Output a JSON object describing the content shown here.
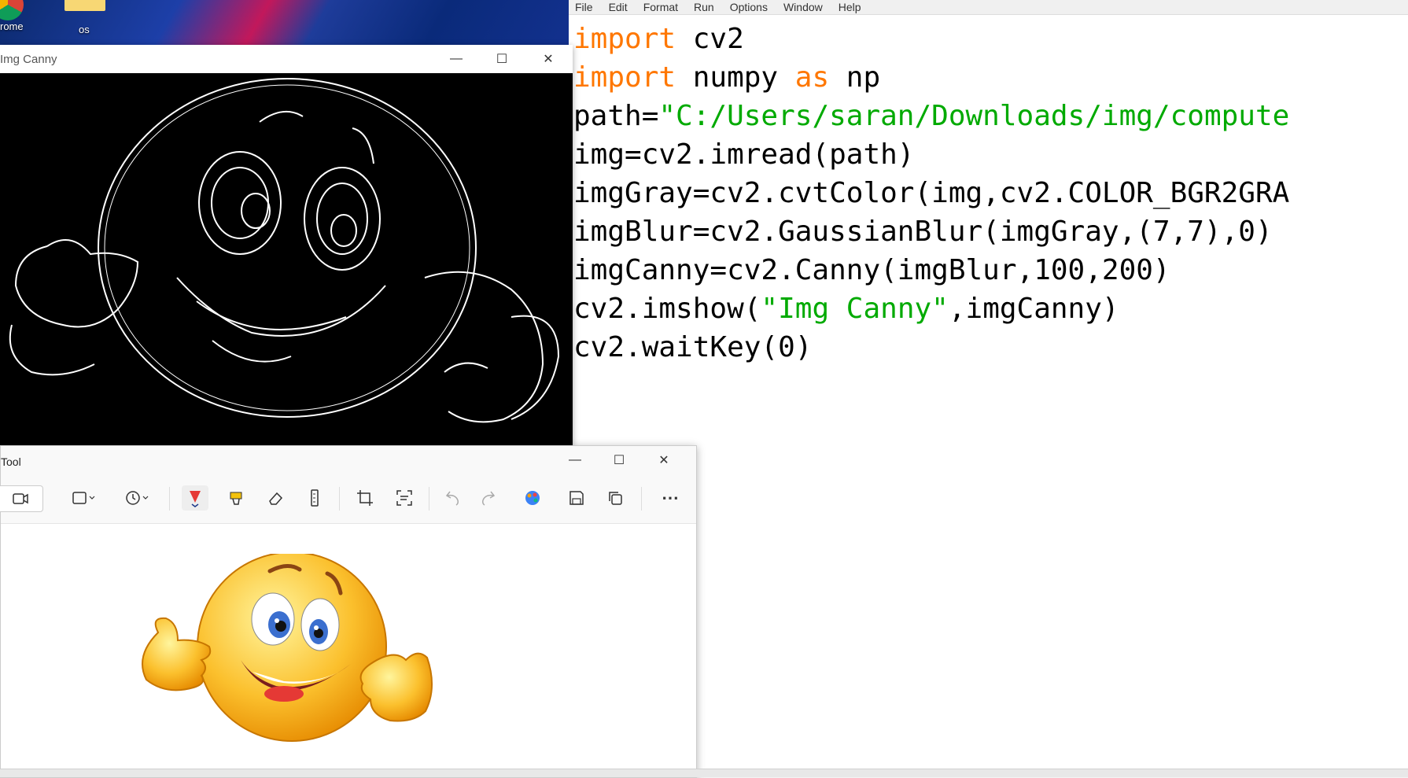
{
  "desktop": {
    "icons": [
      {
        "label": "rome",
        "icon": "chrome-icon"
      },
      {
        "label": "os",
        "icon": "folder-icon"
      }
    ]
  },
  "idle": {
    "menu": [
      "File",
      "Edit",
      "Format",
      "Run",
      "Options",
      "Window",
      "Help"
    ],
    "code": [
      "import cv2",
      "import numpy as np",
      "path=\"C:/Users/saran/Downloads/img/compute",
      "img=cv2.imread(path)",
      "imgGray=cv2.cvtColor(img,cv2.COLOR_BGR2GRA",
      "imgBlur=cv2.GaussianBlur(imgGray,(7,7),0)",
      "imgCanny=cv2.Canny(imgBlur,100,200)",
      "cv2.imshow(\"Img Canny\",imgCanny)",
      "cv2.waitKey(0)"
    ],
    "colors": {
      "keyword": "#ff7700",
      "string": "#00aa00"
    }
  },
  "canny_window": {
    "title": "Img Canny"
  },
  "snip_window": {
    "title": "Tool",
    "toolbar_icons": [
      "video-icon",
      "rectangle-mode-icon",
      "timer-icon",
      "ballpoint-pen-icon",
      "highlighter-icon",
      "eraser-icon",
      "ruler-icon",
      "crop-icon",
      "text-actions-icon",
      "undo-icon",
      "redo-icon",
      "paint-icon",
      "save-icon",
      "copy-icon",
      "more-icon"
    ]
  }
}
